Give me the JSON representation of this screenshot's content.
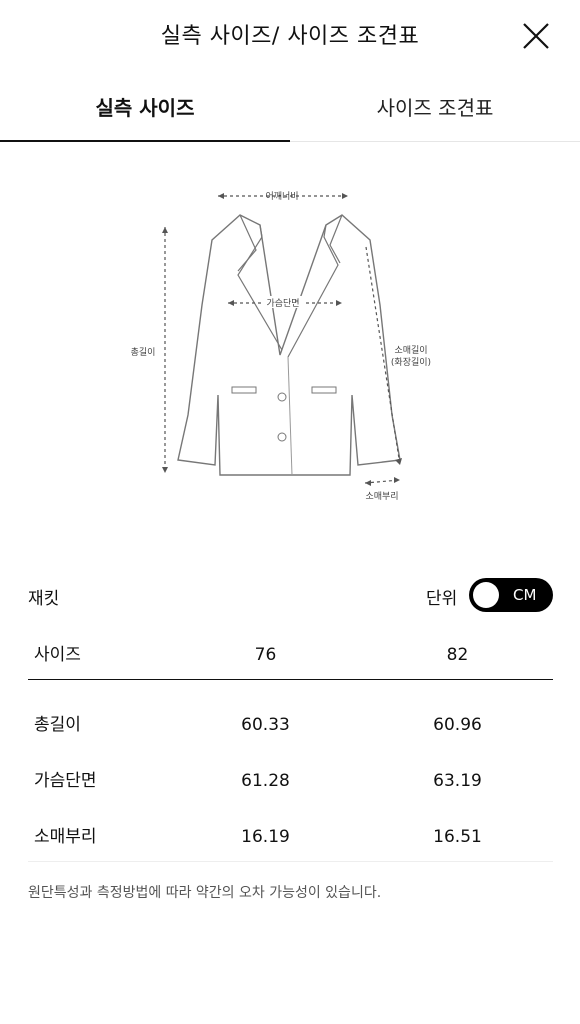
{
  "header": {
    "title": "실측 사이즈/ 사이즈 조견표"
  },
  "tabs": [
    {
      "label": "실측 사이즈",
      "active": true
    },
    {
      "label": "사이즈 조견표",
      "active": false
    }
  ],
  "figure": {
    "shoulder_label": "어깨너비",
    "chest_label": "가슴단면",
    "total_length_label": "총길이",
    "sleeve_label": "소매길이",
    "sleeve_sub_label": "(화장길이)",
    "cuff_label": "소매부리"
  },
  "product": {
    "name": "재킷",
    "unit_label": "단위",
    "unit_value": "CM"
  },
  "table": {
    "headers": [
      "사이즈",
      "76",
      "82"
    ],
    "rows": [
      {
        "label": "총길이",
        "values": [
          "60.33",
          "60.96"
        ]
      },
      {
        "label": "가슴단면",
        "values": [
          "61.28",
          "63.19"
        ]
      },
      {
        "label": "소매부리",
        "values": [
          "16.19",
          "16.51"
        ]
      }
    ]
  },
  "note": "원단특성과 측정방법에 따라 약간의 오차 가능성이 있습니다."
}
